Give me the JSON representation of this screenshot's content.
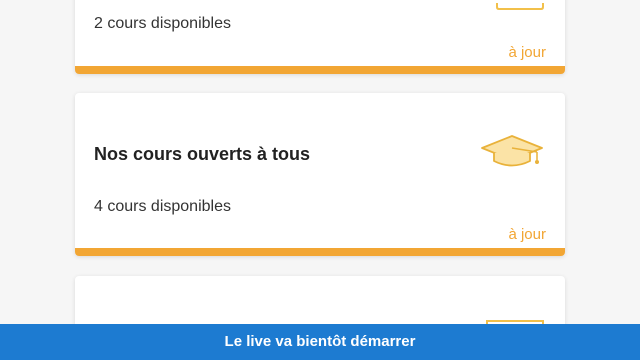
{
  "cards": [
    {
      "subtitle": "2 cours disponibles",
      "status": "à jour",
      "icon": "folder-icon"
    },
    {
      "title": "Nos cours ouverts à tous",
      "subtitle": "4 cours disponibles",
      "status": "à jour",
      "icon": "graduation-cap-icon"
    },
    {
      "icon": "folder-icon"
    }
  ],
  "banner": {
    "label": "Le live va bientôt démarrer"
  },
  "colors": {
    "accent": "#f2a634",
    "banner": "#1d7bd1",
    "background": "#f6f6f6"
  }
}
